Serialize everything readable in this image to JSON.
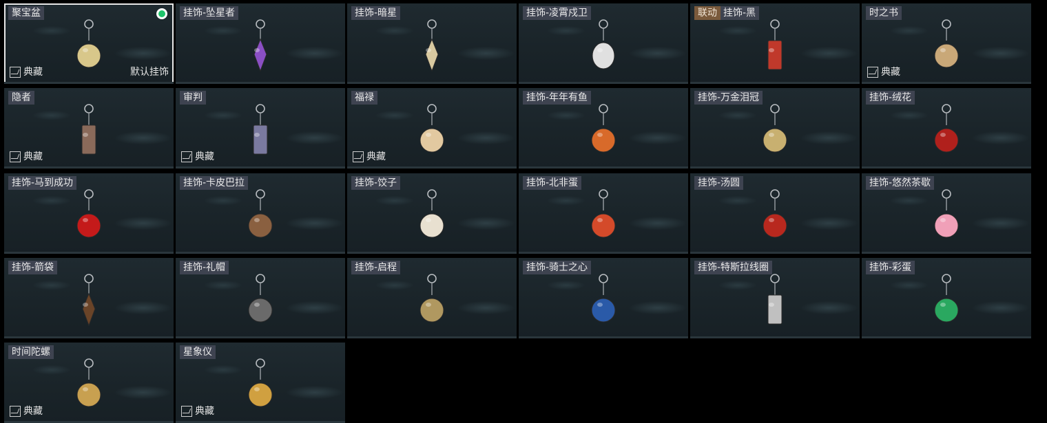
{
  "cards": [
    {
      "label": "聚宝盆",
      "archive": true,
      "default_tag": "默认挂饰",
      "selected": true,
      "equipped": true,
      "icon": "treasure-bowl-icon",
      "accent": "#d8c78a"
    },
    {
      "label": "挂饰-坠星者",
      "archive": false,
      "icon": "purple-crystal-icon",
      "accent": "#8a4fc4"
    },
    {
      "label": "挂饰-暗星",
      "archive": false,
      "icon": "dark-star-icon",
      "accent": "#d8c9a0"
    },
    {
      "label": "挂饰-凌霄戍卫",
      "archive": false,
      "icon": "rocket-icon",
      "accent": "#e0e0e0"
    },
    {
      "label": "挂饰-黑",
      "collab": "联动",
      "archive": false,
      "icon": "card-tag-icon",
      "accent": "#c0392b"
    },
    {
      "label": "时之书",
      "archive": true,
      "icon": "book-of-time-icon",
      "accent": "#c9a878"
    },
    {
      "label": "隐者",
      "archive": true,
      "icon": "hermit-card-icon",
      "accent": "#8a6a5a"
    },
    {
      "label": "审判",
      "archive": true,
      "icon": "judgement-card-icon",
      "accent": "#7a7aa0"
    },
    {
      "label": "福禄",
      "archive": true,
      "icon": "gourd-icon",
      "accent": "#e2c9a0"
    },
    {
      "label": "挂饰-年年有鱼",
      "archive": false,
      "icon": "fish-plate-icon",
      "accent": "#d86a2a"
    },
    {
      "label": "挂饰-万金泪冠",
      "archive": false,
      "icon": "golden-disc-icon",
      "accent": "#c8b070"
    },
    {
      "label": "挂饰-绒花",
      "archive": false,
      "icon": "rose-icon",
      "accent": "#b0201c"
    },
    {
      "label": "挂饰-马到成功",
      "archive": false,
      "icon": "red-horse-icon",
      "accent": "#c41a1a"
    },
    {
      "label": "挂饰-卡皮巴拉",
      "archive": false,
      "icon": "capybara-icon",
      "accent": "#8a6040"
    },
    {
      "label": "挂饰-饺子",
      "archive": false,
      "icon": "dumpling-plate-icon",
      "accent": "#e8e0d0"
    },
    {
      "label": "挂饰-北非蛋",
      "archive": false,
      "icon": "shakshuka-icon",
      "accent": "#d44a2a"
    },
    {
      "label": "挂饰-汤圆",
      "archive": false,
      "icon": "tangyuan-bowl-icon",
      "accent": "#b8281e"
    },
    {
      "label": "挂饰-悠然茶歇",
      "archive": false,
      "icon": "cupcake-icon",
      "accent": "#f0a0b8"
    },
    {
      "label": "挂饰-箭袋",
      "archive": false,
      "icon": "quiver-icon",
      "accent": "#6a4428"
    },
    {
      "label": "挂饰-礼帽",
      "archive": false,
      "icon": "top-hat-icon",
      "accent": "#6a6a6a"
    },
    {
      "label": "挂饰-启程",
      "archive": false,
      "icon": "compass-medal-icon",
      "accent": "#b09860"
    },
    {
      "label": "挂饰-骑士之心",
      "archive": false,
      "icon": "knight-cross-icon",
      "accent": "#2a5aa8"
    },
    {
      "label": "挂饰-特斯拉线圈",
      "archive": false,
      "icon": "tesla-coil-icon",
      "accent": "#c0c0c0"
    },
    {
      "label": "挂饰-彩蛋",
      "archive": false,
      "icon": "green-egg-icon",
      "accent": "#2aa860"
    },
    {
      "label": "时间陀螺",
      "archive": true,
      "icon": "spinning-top-icon",
      "accent": "#c8a050"
    },
    {
      "label": "星象仪",
      "archive": true,
      "icon": "astrolabe-icon",
      "accent": "#d0a040"
    }
  ],
  "archive_label": "典藏"
}
